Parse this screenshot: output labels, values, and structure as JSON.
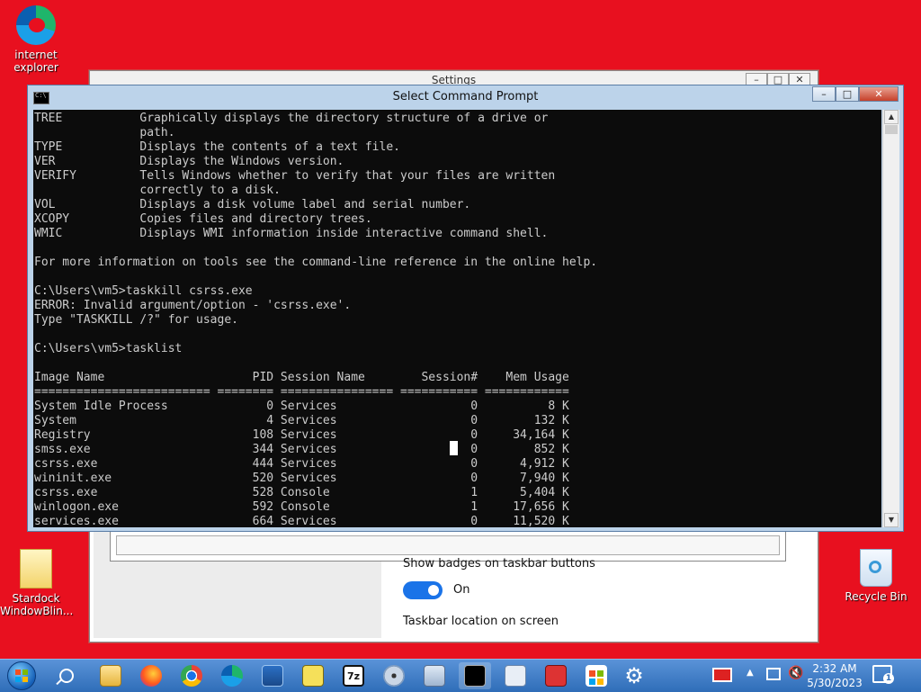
{
  "desktop": {
    "icons": [
      {
        "label_line1": "internet",
        "label_line2": "explorer"
      },
      {
        "label_line1": "Stardock",
        "label_line2": "WindowBlin..."
      },
      {
        "label_line1": "Recycle Bin",
        "label_line2": ""
      }
    ]
  },
  "settings": {
    "title": "Settings",
    "badges_label": "Show badges on taskbar buttons",
    "toggle_state": "On",
    "location_label": "Taskbar location on screen"
  },
  "cmd": {
    "title": "Select Command Prompt",
    "minimize": "–",
    "maximize": "□",
    "close": "✕",
    "lines": [
      "TREE           Graphically displays the directory structure of a drive or",
      "               path.",
      "TYPE           Displays the contents of a text file.",
      "VER            Displays the Windows version.",
      "VERIFY         Tells Windows whether to verify that your files are written",
      "               correctly to a disk.",
      "VOL            Displays a disk volume label and serial number.",
      "XCOPY          Copies files and directory trees.",
      "WMIC           Displays WMI information inside interactive command shell.",
      "",
      "For more information on tools see the command-line reference in the online help.",
      "",
      "C:\\Users\\vm5>taskkill csrss.exe",
      "ERROR: Invalid argument/option - 'csrss.exe'.",
      "Type \"TASKKILL /?\" for usage.",
      "",
      "C:\\Users\\vm5>tasklist",
      "",
      "Image Name                     PID Session Name        Session#    Mem Usage",
      "========================= ======== ================ =========== ============",
      "System Idle Process              0 Services                   0          8 K",
      "System                           4 Services                   0        132 K",
      "Registry                       108 Services                   0     34,164 K",
      "smss.exe                       344 Services                   0        852 K",
      "csrss.exe                      444 Services                   0      4,912 K",
      "wininit.exe                    520 Services                   0      7,940 K",
      "csrss.exe                      528 Console                    1      5,404 K",
      "winlogon.exe                   592 Console                    1     17,656 K",
      "services.exe                   664 Services                   0     11,520 K"
    ]
  },
  "taskbar": {
    "items": [
      "start",
      "search",
      "file-explorer",
      "firefox",
      "chrome",
      "edge",
      "photos",
      "notepad",
      "7zip",
      "disc-tool",
      "image-viewer",
      "command-prompt",
      "document-viewer",
      "toolbox",
      "store",
      "settings"
    ],
    "time": "2:32 AM",
    "date": "5/30/2023",
    "notification_count": "1"
  }
}
